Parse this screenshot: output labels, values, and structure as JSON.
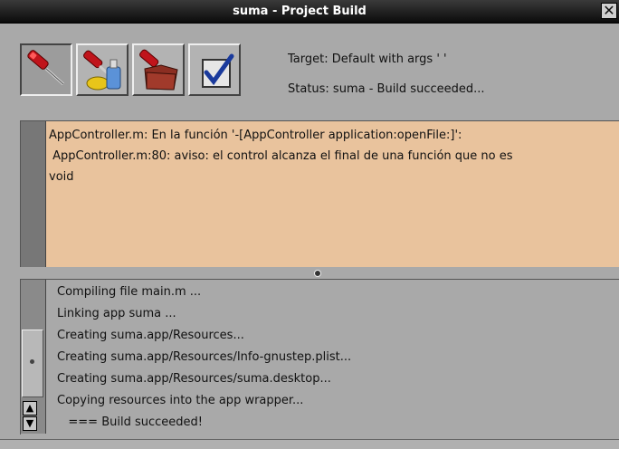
{
  "window": {
    "title": "suma - Project Build",
    "close_glyph": "✕"
  },
  "toolbar": {
    "buttons": [
      {
        "name": "build",
        "icon": "screwdriver-icon"
      },
      {
        "name": "clean",
        "icon": "cleaner-bottle-icon"
      },
      {
        "name": "install",
        "icon": "folder-tool-icon"
      },
      {
        "name": "options",
        "icon": "checkmark-icon"
      }
    ]
  },
  "info": {
    "target": "Target: Default with args ' '",
    "status": "Status: suma - Build succeeded..."
  },
  "errors": {
    "lines": [
      "AppController.m: En la función '-[AppController application:openFile:]':",
      " AppController.m:80: aviso: el control alcanza el final de una función que no es",
      "void"
    ],
    "background": "#e9c39d"
  },
  "log": {
    "lines": [
      "Compiling file main.m ...",
      "Linking app suma ...",
      "Creating suma.app/Resources...",
      "Creating suma.app/Resources/Info-gnustep.plist...",
      "Creating suma.app/Resources/suma.desktop...",
      "Copying resources into the app wrapper...",
      "   === Build succeeded!"
    ],
    "scroll_up": "▲",
    "scroll_down": "▼"
  }
}
